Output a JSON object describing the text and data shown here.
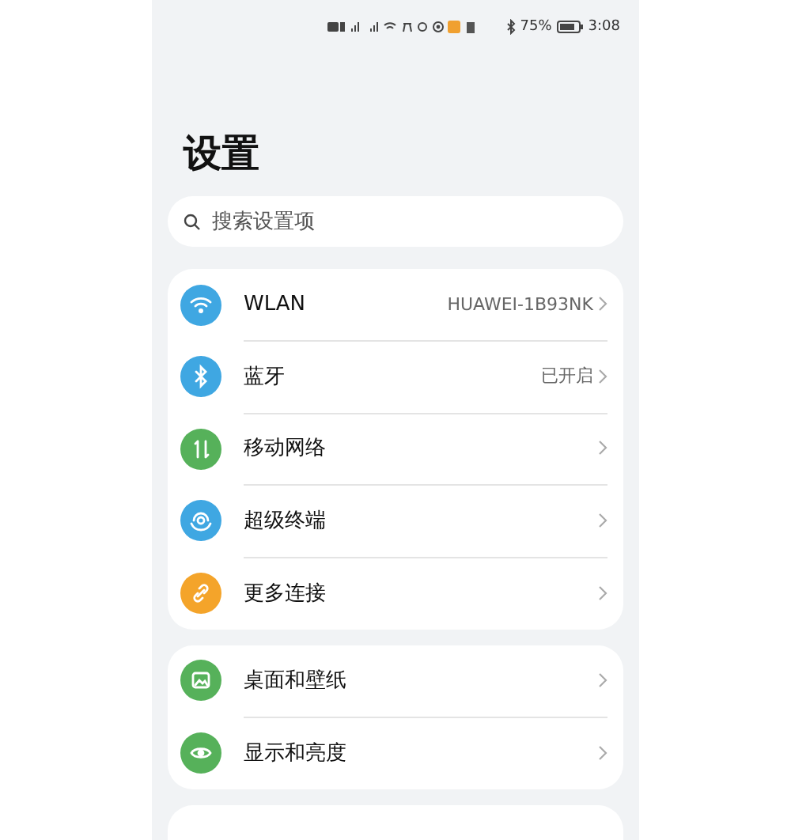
{
  "status_bar": {
    "battery": "75%",
    "time": "3:08"
  },
  "title": "设置",
  "search": {
    "placeholder": "搜索设置项"
  },
  "groups": [
    {
      "items": [
        {
          "kind": "wifi",
          "color": "#3fa7e2",
          "label": "WLAN",
          "value": "HUAWEI-1B93NK"
        },
        {
          "kind": "bluetooth",
          "color": "#3fa7e2",
          "label": "蓝牙",
          "value": "已开启"
        },
        {
          "kind": "mobile",
          "color": "#56b15a",
          "label": "移动网络"
        },
        {
          "kind": "devices",
          "color": "#3fa7e2",
          "label": "超级终端"
        },
        {
          "kind": "link",
          "color": "#f4a42a",
          "label": "更多连接"
        }
      ]
    },
    {
      "items": [
        {
          "kind": "wallpaper",
          "color": "#56b15a",
          "label": "桌面和壁纸"
        },
        {
          "kind": "display",
          "color": "#56b15a",
          "label": "显示和亮度"
        }
      ]
    }
  ],
  "next_card_peek": true
}
